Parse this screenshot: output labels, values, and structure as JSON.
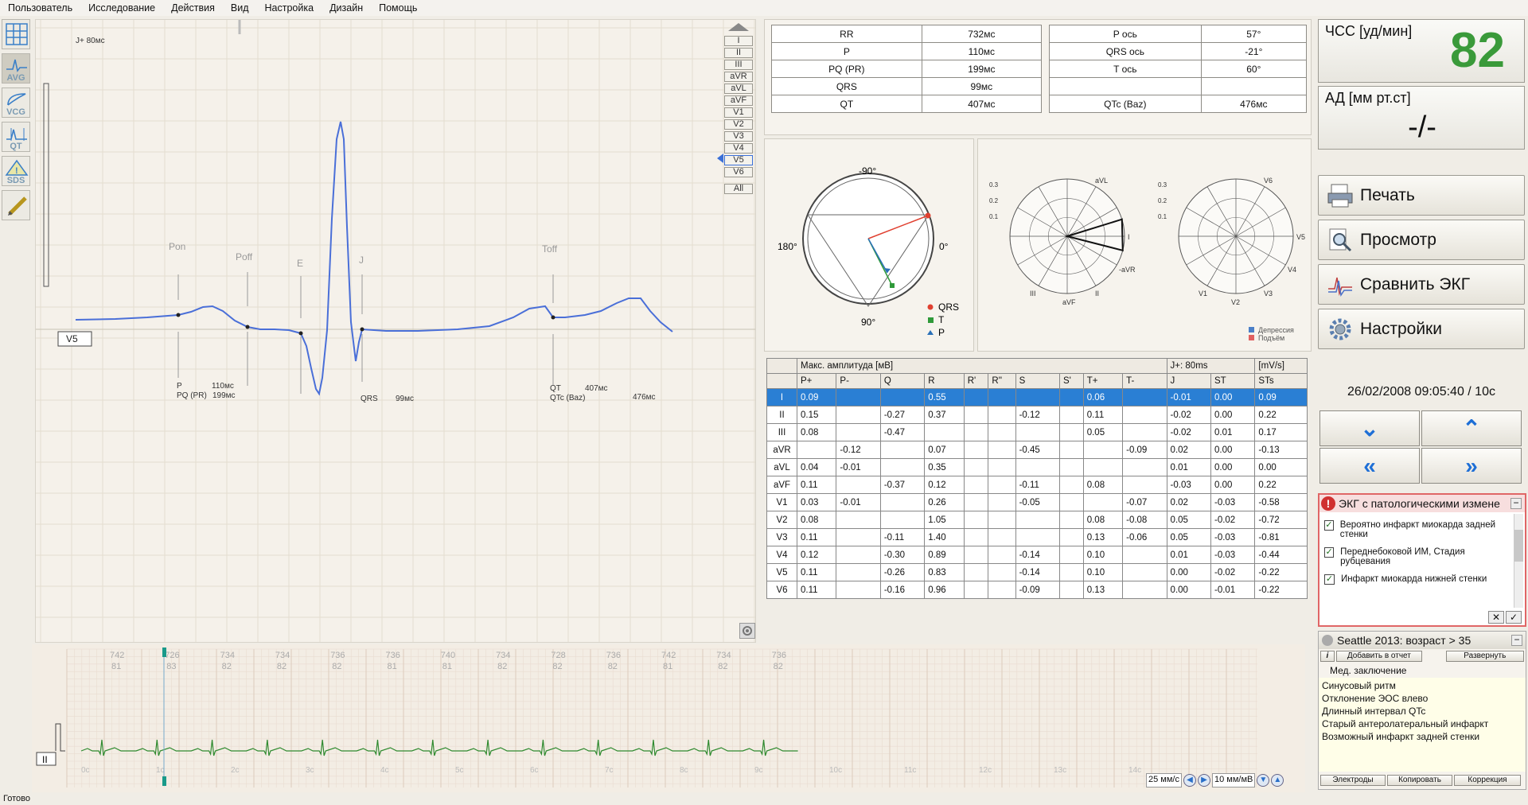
{
  "menu": [
    "Пользователь",
    "Исследование",
    "Действия",
    "Вид",
    "Настройка",
    "Дизайн",
    "Помощь"
  ],
  "toolbar": {
    "avg": "AVG",
    "vcg": "VCG",
    "qt": "QT",
    "sds": "SDS"
  },
  "leads": [
    "I",
    "II",
    "III",
    "aVR",
    "aVL",
    "aVF",
    "V1",
    "V2",
    "V3",
    "V4",
    "V5",
    "V6"
  ],
  "lead_all": "All",
  "wave": {
    "jlabel": "J+ 80мс",
    "lead": "V5",
    "pon": "Pon",
    "poff": "Poff",
    "e": "E",
    "j": "J",
    "toff": "Toff",
    "p": "P",
    "pq": "PQ (PR)",
    "pq_val": "199мс",
    "p_val": "110мс",
    "qrs": "QRS",
    "qrs_val": "99мс",
    "qt": "QT",
    "qt_val": "407мс",
    "qtc": "QTc (Baz)",
    "qtc_val": "476мс"
  },
  "intervals_left": [
    [
      "RR",
      "732мс"
    ],
    [
      "P",
      "110мс"
    ],
    [
      "PQ (PR)",
      "199мс"
    ],
    [
      "QRS",
      "99мс"
    ],
    [
      "QT",
      "407мс"
    ]
  ],
  "intervals_right": [
    [
      "P ось",
      "57°"
    ],
    [
      "QRS ось",
      "-21°"
    ],
    [
      "T ось",
      "60°"
    ],
    [
      "",
      ""
    ],
    [
      "QTc (Baz)",
      "476мс"
    ]
  ],
  "axis": {
    "top": "-90°",
    "bottom": "90°",
    "left": "180°",
    "right": "0°",
    "legend_qrs": "QRS",
    "legend_t": "T",
    "legend_p": "P"
  },
  "polar1": {
    "labels": [
      "aVL",
      "I",
      "-aVR",
      "II",
      "aVF",
      "III"
    ],
    "ticks": [
      "0.3",
      "0.2",
      "0.1"
    ]
  },
  "polar2": {
    "labels": [
      "V6",
      "V5",
      "V4",
      "V3",
      "V2",
      "V1"
    ],
    "ticks": [
      "0.3",
      "0.2",
      "0.1"
    ]
  },
  "polar_legend": {
    "dep": "Депрессия",
    "rise": "Подъём"
  },
  "ampl": {
    "title": "Макс. амплитуда [мВ]",
    "jtitle": "J+: 80ms",
    "stsunit": "[mV/s]",
    "cols": [
      "P+",
      "P-",
      "Q",
      "R",
      "R'",
      "R''",
      "S",
      "S'",
      "T+",
      "T-",
      "J",
      "ST",
      "STs"
    ],
    "rows": [
      [
        "I",
        "0.09",
        "",
        "",
        "0.55",
        "",
        "",
        "",
        "",
        "0.06",
        "",
        "-0.01",
        "0.00",
        "0.09"
      ],
      [
        "II",
        "0.15",
        "",
        "-0.27",
        "0.37",
        "",
        "",
        "-0.12",
        "",
        "0.11",
        "",
        "-0.02",
        "0.00",
        "0.22"
      ],
      [
        "III",
        "0.08",
        "",
        "-0.47",
        "",
        "",
        "",
        "",
        "",
        "0.05",
        "",
        "-0.02",
        "0.01",
        "0.17"
      ],
      [
        "aVR",
        "",
        "-0.12",
        "",
        "0.07",
        "",
        "",
        "-0.45",
        "",
        "",
        "-0.09",
        "0.02",
        "0.00",
        "-0.13"
      ],
      [
        "aVL",
        "0.04",
        "-0.01",
        "",
        "0.35",
        "",
        "",
        "",
        "",
        "",
        "",
        "0.01",
        "0.00",
        "0.00"
      ],
      [
        "aVF",
        "0.11",
        "",
        "-0.37",
        "0.12",
        "",
        "",
        "-0.11",
        "",
        "0.08",
        "",
        "-0.03",
        "0.00",
        "0.22"
      ],
      [
        "V1",
        "0.03",
        "-0.01",
        "",
        "0.26",
        "",
        "",
        "-0.05",
        "",
        "",
        "-0.07",
        "0.02",
        "-0.03",
        "-0.58"
      ],
      [
        "V2",
        "0.08",
        "",
        "",
        "1.05",
        "",
        "",
        "",
        "",
        "0.08",
        "-0.08",
        "0.05",
        "-0.02",
        "-0.72"
      ],
      [
        "V3",
        "0.11",
        "",
        "-0.11",
        "1.40",
        "",
        "",
        "",
        "",
        "0.13",
        "-0.06",
        "0.05",
        "-0.03",
        "-0.81"
      ],
      [
        "V4",
        "0.12",
        "",
        "-0.30",
        "0.89",
        "",
        "",
        "-0.14",
        "",
        "0.10",
        "",
        "0.01",
        "-0.03",
        "-0.44"
      ],
      [
        "V5",
        "0.11",
        "",
        "-0.26",
        "0.83",
        "",
        "",
        "-0.14",
        "",
        "0.10",
        "",
        "0.00",
        "-0.02",
        "-0.22"
      ],
      [
        "V6",
        "0.11",
        "",
        "-0.16",
        "0.96",
        "",
        "",
        "-0.09",
        "",
        "0.13",
        "",
        "0.00",
        "-0.01",
        "-0.22"
      ]
    ]
  },
  "hr": {
    "label": "ЧСС [уд/мин]",
    "value": "82"
  },
  "bp": {
    "label": "АД [мм рт.ст]",
    "value": "-/-"
  },
  "buttons": {
    "print": "Печать",
    "preview": "Просмотр",
    "compare": "Сравнить ЭКГ",
    "settings": "Настройки"
  },
  "datetime": "26/02/2008 09:05:40 / 10с",
  "colors": {
    "hr": "#3a9a3a",
    "accent": "#1e6fd6",
    "alert": "#d03030",
    "wave": "#4a6fd8",
    "rhythm": "#2f8a2f"
  },
  "pathology": {
    "title": "ЭКГ с патологическими измене",
    "items": [
      "Вероятно инфаркт миокарда задней стенки",
      "Переднебоковой ИМ, Стадия рубцевания",
      "Инфаркт миокарда нижней стенки"
    ]
  },
  "seattle": {
    "title": "Seattle 2013: возраст > 35",
    "add": "Добавить в отчет",
    "expand": "Развернуть",
    "conclusion_title": "Мед. заключение",
    "conclusions": [
      "Синусовый ритм",
      "Отклонение ЭОС влево",
      "Длинный интервал QTc",
      "Старый антеролатеральный инфаркт",
      "Возможный инфаркт задней стенки"
    ],
    "b1": "Электроды",
    "b2": "Копировать",
    "b3": "Коррекция"
  },
  "rhythm": {
    "rr": [
      "742",
      "726",
      "734",
      "734",
      "736",
      "736",
      "740",
      "734",
      "728",
      "736",
      "742",
      "734",
      "736"
    ],
    "hr": [
      "81",
      "83",
      "82",
      "82",
      "82",
      "81",
      "81",
      "82",
      "82",
      "82",
      "81",
      "82",
      "82"
    ],
    "secs": [
      "0c",
      "1c",
      "2c",
      "3c",
      "4c",
      "5c",
      "6c",
      "7c",
      "8c",
      "9c",
      "10c",
      "11c",
      "12c",
      "13c",
      "14c"
    ],
    "lead": "II"
  },
  "speed": "25 мм/с",
  "gain": "10 мм/мВ",
  "status": "Готово"
}
